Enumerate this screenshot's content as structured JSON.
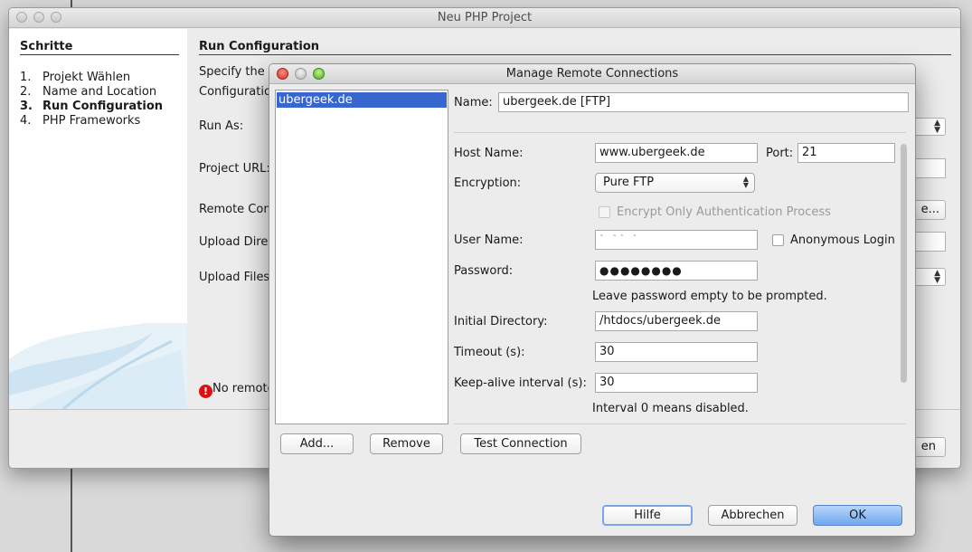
{
  "back_window": {
    "title": "Neu PHP Project",
    "steps_header": "Schritte",
    "steps": [
      {
        "num": "1.",
        "label": "Projekt Wählen"
      },
      {
        "num": "2.",
        "label": "Name and Location"
      },
      {
        "num": "3.",
        "label": "Run Configuration"
      },
      {
        "num": "4.",
        "label": "PHP Frameworks"
      }
    ],
    "section_header": "Run Configuration",
    "specify_label": "Specify the w",
    "configuration_label": "Configuratio",
    "run_as_label": "Run As:",
    "project_url_label": "Project URL:",
    "remote_conn_label": "Remote Conn",
    "manage_button_fragment": "e...",
    "upload_dir_label": "Upload Direc",
    "upload_files_label": "Upload Files",
    "error_text": "No remote",
    "finish_button_fragment": "en"
  },
  "dialog": {
    "title": "Manage Remote Connections",
    "connections": [
      "ubergeek.de"
    ],
    "name_label": "Name:",
    "name_value": "ubergeek.de [FTP]",
    "host_label": "Host Name:",
    "host_value": "www.ubergeek.de",
    "port_label": "Port:",
    "port_value": "21",
    "encryption_label": "Encryption:",
    "encryption_value": "Pure FTP",
    "encrypt_auth_label": "Encrypt Only Authentication Process",
    "user_label": "User Name:",
    "user_value": "ˆ ˆˆ ˆ",
    "anonymous_label": "Anonymous Login",
    "password_label": "Password:",
    "password_value": "●●●●●●●●",
    "password_hint": "Leave password empty to be prompted.",
    "initial_dir_label": "Initial Directory:",
    "initial_dir_value": "/htdocs/ubergeek.de",
    "timeout_label": "Timeout (s):",
    "timeout_value": "30",
    "keepalive_label": "Keep-alive interval (s):",
    "keepalive_value": "30",
    "keepalive_hint": "Interval 0 means disabled.",
    "buttons": {
      "add": "Add...",
      "remove": "Remove",
      "test": "Test Connection",
      "help": "Hilfe",
      "cancel": "Abbrechen",
      "ok": "OK"
    }
  },
  "colors": {
    "selection": "#3766cf",
    "error_icon": "#dd1111",
    "ok_button": "#6fa7ee"
  }
}
